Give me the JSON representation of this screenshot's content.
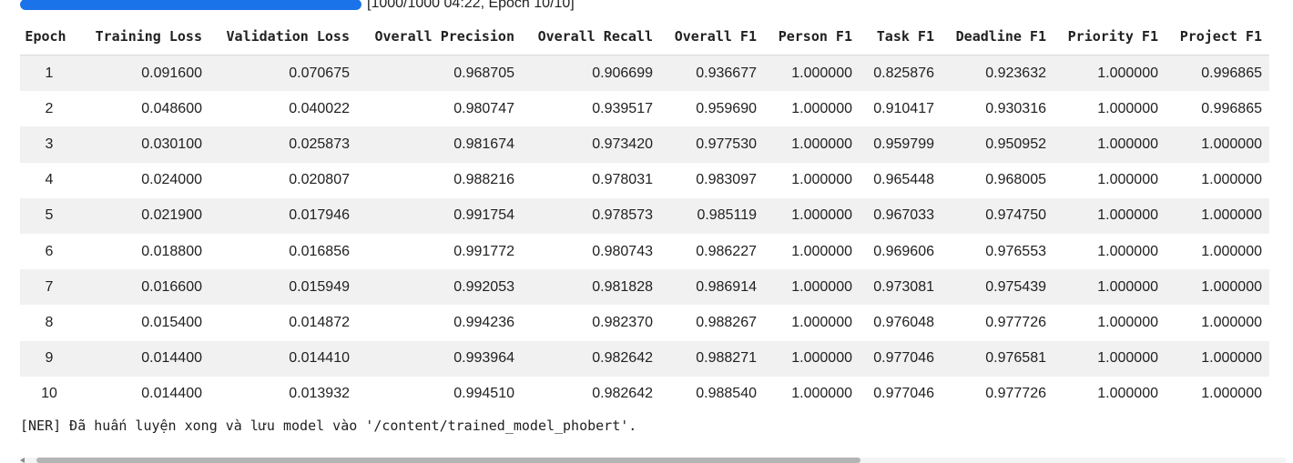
{
  "progress": {
    "fraction": 1.0,
    "label": "[1000/1000 04:22, Epoch 10/10]",
    "color": "#1a73e8"
  },
  "table": {
    "columns": [
      "Epoch",
      "Training Loss",
      "Validation Loss",
      "Overall Precision",
      "Overall Recall",
      "Overall F1",
      "Person F1",
      "Task F1",
      "Deadline F1",
      "Priority F1",
      "Project F1"
    ],
    "rows": [
      [
        "1",
        "0.091600",
        "0.070675",
        "0.968705",
        "0.906699",
        "0.936677",
        "1.000000",
        "0.825876",
        "0.923632",
        "1.000000",
        "0.996865"
      ],
      [
        "2",
        "0.048600",
        "0.040022",
        "0.980747",
        "0.939517",
        "0.959690",
        "1.000000",
        "0.910417",
        "0.930316",
        "1.000000",
        "0.996865"
      ],
      [
        "3",
        "0.030100",
        "0.025873",
        "0.981674",
        "0.973420",
        "0.977530",
        "1.000000",
        "0.959799",
        "0.950952",
        "1.000000",
        "1.000000"
      ],
      [
        "4",
        "0.024000",
        "0.020807",
        "0.988216",
        "0.978031",
        "0.983097",
        "1.000000",
        "0.965448",
        "0.968005",
        "1.000000",
        "1.000000"
      ],
      [
        "5",
        "0.021900",
        "0.017946",
        "0.991754",
        "0.978573",
        "0.985119",
        "1.000000",
        "0.967033",
        "0.974750",
        "1.000000",
        "1.000000"
      ],
      [
        "6",
        "0.018800",
        "0.016856",
        "0.991772",
        "0.980743",
        "0.986227",
        "1.000000",
        "0.969606",
        "0.976553",
        "1.000000",
        "1.000000"
      ],
      [
        "7",
        "0.016600",
        "0.015949",
        "0.992053",
        "0.981828",
        "0.986914",
        "1.000000",
        "0.973081",
        "0.975439",
        "1.000000",
        "1.000000"
      ],
      [
        "8",
        "0.015400",
        "0.014872",
        "0.994236",
        "0.982370",
        "0.988267",
        "1.000000",
        "0.976048",
        "0.977726",
        "1.000000",
        "1.000000"
      ],
      [
        "9",
        "0.014400",
        "0.014410",
        "0.993964",
        "0.982642",
        "0.988271",
        "1.000000",
        "0.977046",
        "0.976581",
        "1.000000",
        "1.000000"
      ],
      [
        "10",
        "0.014400",
        "0.013932",
        "0.994510",
        "0.982642",
        "0.988540",
        "1.000000",
        "0.977046",
        "0.977726",
        "1.000000",
        "1.000000"
      ]
    ]
  },
  "log": {
    "message": "[NER] Đã huấn luyện xong và lưu model vào '/content/trained_model_phobert'."
  },
  "icons": {
    "scroll_left": "scroll-left-arrow-icon"
  }
}
